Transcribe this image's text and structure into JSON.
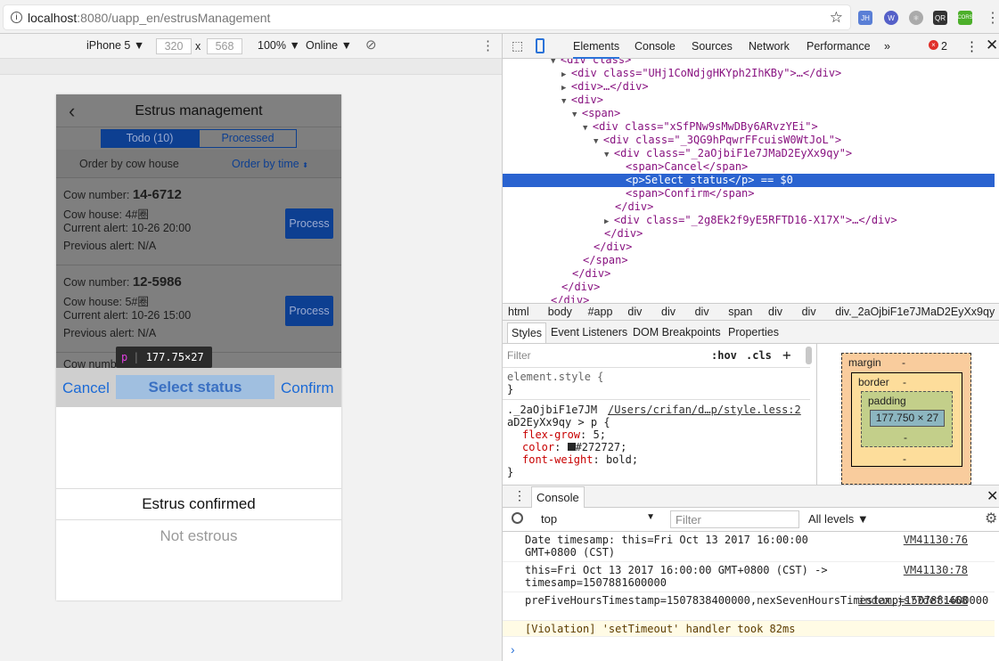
{
  "browser": {
    "host": "localhost",
    "path": ":8080/uapp_en/estrusManagement",
    "extensions": [
      "JH",
      "W",
      "react",
      "QR",
      "CORS"
    ]
  },
  "device_toolbar": {
    "device": "iPhone 5 ▼",
    "width": "320",
    "times": "x",
    "height": "568",
    "zoom": "100% ▼",
    "network": "Online ▼"
  },
  "app": {
    "title": "Estrus management",
    "tabs": [
      "Todo (10)",
      "Processed"
    ],
    "order_house": "Order by cow house",
    "order_time": "Order by time",
    "cards": [
      {
        "number_label": "Cow number: ",
        "number": "14-6712",
        "house": "Cow house: 4#圈",
        "current": "Current alert: 10-26 20:00",
        "previous": "Previous alert: N/A",
        "button": "Process"
      },
      {
        "number_label": "Cow number: ",
        "number": "12-5986",
        "house": "Cow house: 5#圈",
        "current": "Current alert: 10-26 15:00",
        "previous": "Previous alert: N/A",
        "button": "Process"
      }
    ],
    "partial_card": "Cow numb",
    "picker": {
      "cancel": "Cancel",
      "title": "Select status",
      "confirm": "Confirm",
      "options": [
        "Estrus confirmed",
        "Not estrous"
      ]
    },
    "tooltip": {
      "tag": "p",
      "size": "177.75×27"
    }
  },
  "devtools": {
    "tabs": [
      "Elements",
      "Console",
      "Sources",
      "Network",
      "Performance",
      "»"
    ],
    "errors": "2",
    "tree": [
      {
        "indent": 4,
        "arrow": "▼",
        "html": "<div class>"
      },
      {
        "indent": 5,
        "arrow": "▶",
        "html": "<div class=\"UHj1CoNdjgHKYph2IhKBy\">…</div>"
      },
      {
        "indent": 5,
        "arrow": "▶",
        "html": "<div>…</div>"
      },
      {
        "indent": 5,
        "arrow": "▼",
        "html": "<div>"
      },
      {
        "indent": 6,
        "arrow": "▼",
        "html": "<span>"
      },
      {
        "indent": 7,
        "arrow": "▼",
        "html": "<div class=\"xSfPNw9sMwDBy6ARvzYEi\">"
      },
      {
        "indent": 8,
        "arrow": "▼",
        "html": "<div class=\"_3QG9hPqwrFFcuisW0WtJoL\">"
      },
      {
        "indent": 9,
        "arrow": "▼",
        "html": "<div class=\"_2aOjbiF1e7JMaD2EyXx9qy\">"
      },
      {
        "indent": 10,
        "arrow": "",
        "html": "<span>Cancel</span>"
      },
      {
        "indent": 10,
        "arrow": "",
        "html": "<p>Select status</p> == $0",
        "selected": true
      },
      {
        "indent": 10,
        "arrow": "",
        "html": "<span>Confirm</span>"
      },
      {
        "indent": 9,
        "arrow": "",
        "html": "</div>"
      },
      {
        "indent": 9,
        "arrow": "▶",
        "html": "<div class=\"_2g8Ek2f9yE5RFTD16-X17X\">…</div>"
      },
      {
        "indent": 8,
        "arrow": "",
        "html": "</div>"
      },
      {
        "indent": 7,
        "arrow": "",
        "html": "</div>"
      },
      {
        "indent": 6,
        "arrow": "",
        "html": "</span>"
      },
      {
        "indent": 5,
        "arrow": "",
        "html": "</div>"
      },
      {
        "indent": 4,
        "arrow": "",
        "html": "</div>"
      },
      {
        "indent": 3,
        "arrow": "",
        "html": "</div>"
      }
    ],
    "breadcrumbs": [
      "html",
      "body",
      "#app",
      "div",
      "div",
      "div",
      "span",
      "div",
      "div",
      "div._2aOjbiF1e7JMaD2EyXx9qy",
      "p"
    ],
    "subtabs": [
      "Styles",
      "Event Listeners",
      "DOM Breakpoints",
      "Properties"
    ],
    "styles": {
      "filter": "Filter",
      "hov": ":hov",
      "cls": ".cls",
      "plus": "+",
      "element_style": "element.style {",
      "close": "}",
      "selector1": "._2aOjbiF1e7JM",
      "selector2": "aD2EyXx9qy > p {",
      "source": "/Users/crifan/d…p/style.less:2",
      "props": [
        {
          "name": "flex-grow",
          "value": "5;"
        },
        {
          "name": "color",
          "value": "#272727;",
          "swatch": "#272727"
        },
        {
          "name": "font-weight",
          "value": "bold;"
        }
      ]
    },
    "box_model": {
      "margin": "margin",
      "border": "border",
      "padding": "padding",
      "dash": "-",
      "content": "177.750 × 27"
    },
    "console": {
      "tab": "Console",
      "context": "top",
      "filter": "Filter",
      "levels": "All levels ▼",
      "messages": [
        {
          "text": "Date timesamp: this=Fri Oct 13 2017 16:00:00 GMT+0800 (CST)",
          "source": "VM41130:76"
        },
        {
          "text": "this=Fri Oct 13 2017 16:00:00 GMT+0800 (CST) -> timesamp=1507881600000",
          "source": "VM41130:78"
        },
        {
          "text": "preFiveHoursTimestamp=1507838400000,nexSevenHoursTimestamp=1507881600000",
          "source": "index.js?7def:468"
        },
        {
          "text": "[Violation] 'setTimeout' handler took 82ms",
          "source": "",
          "warning": true
        }
      ],
      "prompt": "›"
    }
  }
}
